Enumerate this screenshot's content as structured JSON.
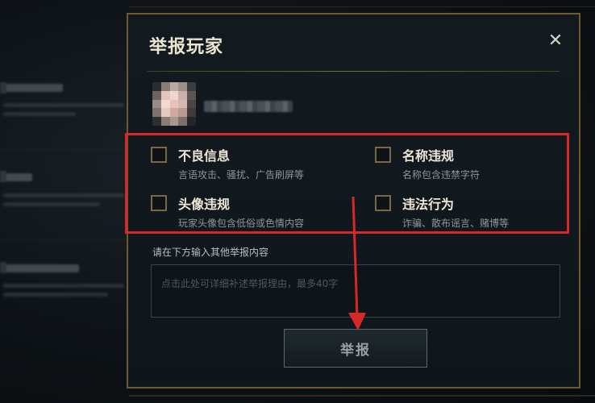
{
  "dialog": {
    "title": "举报玩家",
    "close_icon": "close-icon",
    "player": {
      "avatar_icon": "pixelated-avatar"
    },
    "reasons": [
      {
        "label": "不良信息",
        "description": "言语攻击、骚扰、广告刷屏等",
        "checked": false
      },
      {
        "label": "名称违规",
        "description": "名称包含违禁字符",
        "checked": false
      },
      {
        "label": "头像违规",
        "description": "玩家头像包含低俗或色情内容",
        "checked": false
      },
      {
        "label": "违法行为",
        "description": "诈骗、散布谣言、赌博等",
        "checked": false
      }
    ],
    "detail_label": "请在下方输入其他举报内容",
    "detail_placeholder": "点击此处可详细补述举报理由，最多40字",
    "submit_label": "举报"
  },
  "annotation": {
    "highlight_color": "#d72828",
    "arrow_color": "#d72828"
  }
}
